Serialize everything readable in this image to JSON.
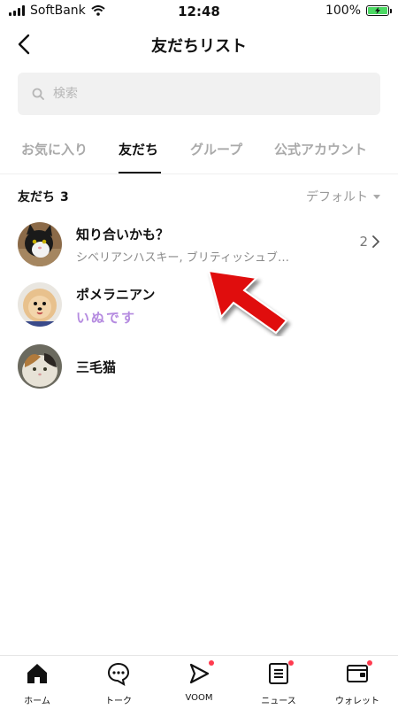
{
  "status_bar": {
    "carrier": "SoftBank",
    "time": "12:48",
    "battery": "100%"
  },
  "header": {
    "title": "友だちリスト",
    "back_icon": "chevron-left-icon"
  },
  "search": {
    "placeholder": "検索"
  },
  "tabs": [
    {
      "label": "お気に入り",
      "active": false
    },
    {
      "label": "友だち",
      "active": true
    },
    {
      "label": "グループ",
      "active": false
    },
    {
      "label": "公式アカウント",
      "active": false
    }
  ],
  "section": {
    "label": "友だち",
    "count": "3",
    "sort": "デフォルト"
  },
  "list": [
    {
      "name": "知り合いかも？",
      "subtitle": "シベリアンハスキー, ブリティッシュブ…",
      "count": "2"
    },
    {
      "name": "ポメラニアン",
      "status": "いぬです"
    },
    {
      "name": "三毛猫"
    }
  ],
  "bottom_nav": [
    {
      "label": "ホーム",
      "icon": "home-icon"
    },
    {
      "label": "トーク",
      "icon": "chat-icon"
    },
    {
      "label": "VOOM",
      "icon": "voom-icon",
      "badge": true
    },
    {
      "label": "ニュース",
      "icon": "news-icon",
      "badge": true
    },
    {
      "label": "ウォレット",
      "icon": "wallet-icon",
      "badge": true
    }
  ],
  "colors": {
    "accent": "#111111",
    "badge": "#ff3b4f",
    "battery": "#4cd964",
    "annotation_arrow": "#e01010"
  }
}
